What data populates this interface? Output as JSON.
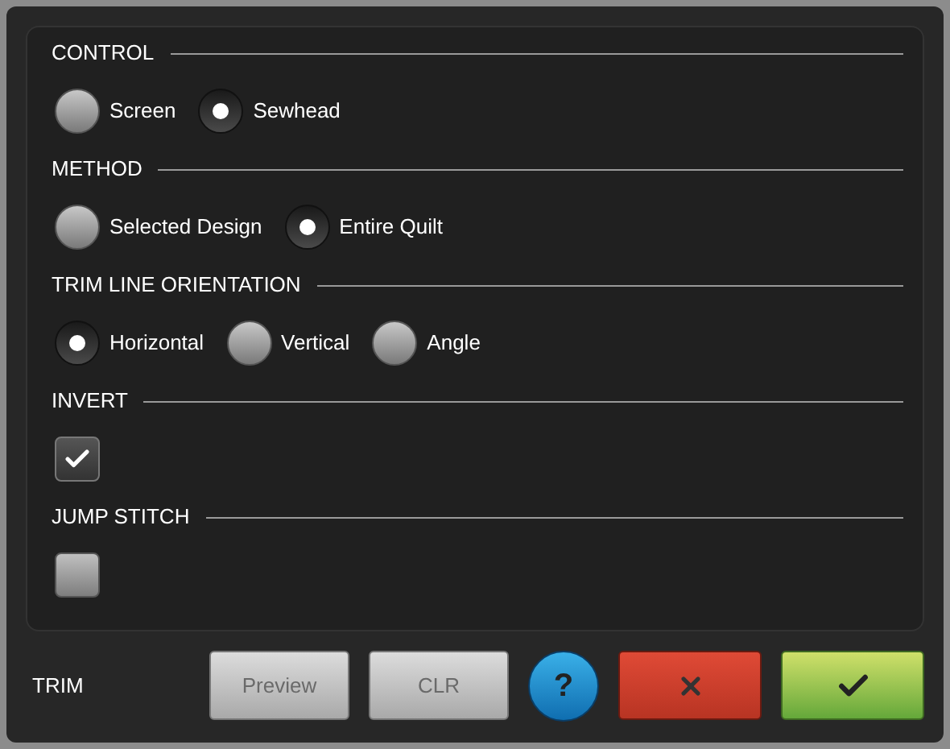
{
  "sections": [
    {
      "title": "CONTROL",
      "kind": "radio",
      "options": [
        {
          "label": "Screen",
          "selected": false
        },
        {
          "label": "Sewhead",
          "selected": true
        }
      ]
    },
    {
      "title": "METHOD",
      "kind": "radio",
      "options": [
        {
          "label": "Selected Design",
          "selected": false
        },
        {
          "label": "Entire Quilt",
          "selected": true
        }
      ]
    },
    {
      "title": "TRIM LINE ORIENTATION",
      "kind": "radio",
      "options": [
        {
          "label": "Horizontal",
          "selected": true
        },
        {
          "label": "Vertical",
          "selected": false
        },
        {
          "label": "Angle",
          "selected": false
        }
      ]
    },
    {
      "title": "INVERT",
      "kind": "checkbox",
      "checked": true
    },
    {
      "title": "JUMP STITCH",
      "kind": "checkbox",
      "checked": false
    }
  ],
  "footer": {
    "title": "TRIM",
    "buttons": [
      {
        "label": "Preview",
        "kind": "gray"
      },
      {
        "label": "CLR",
        "kind": "gray"
      },
      {
        "label": "?",
        "kind": "help"
      },
      {
        "kind": "cancel"
      },
      {
        "kind": "ok"
      }
    ]
  }
}
